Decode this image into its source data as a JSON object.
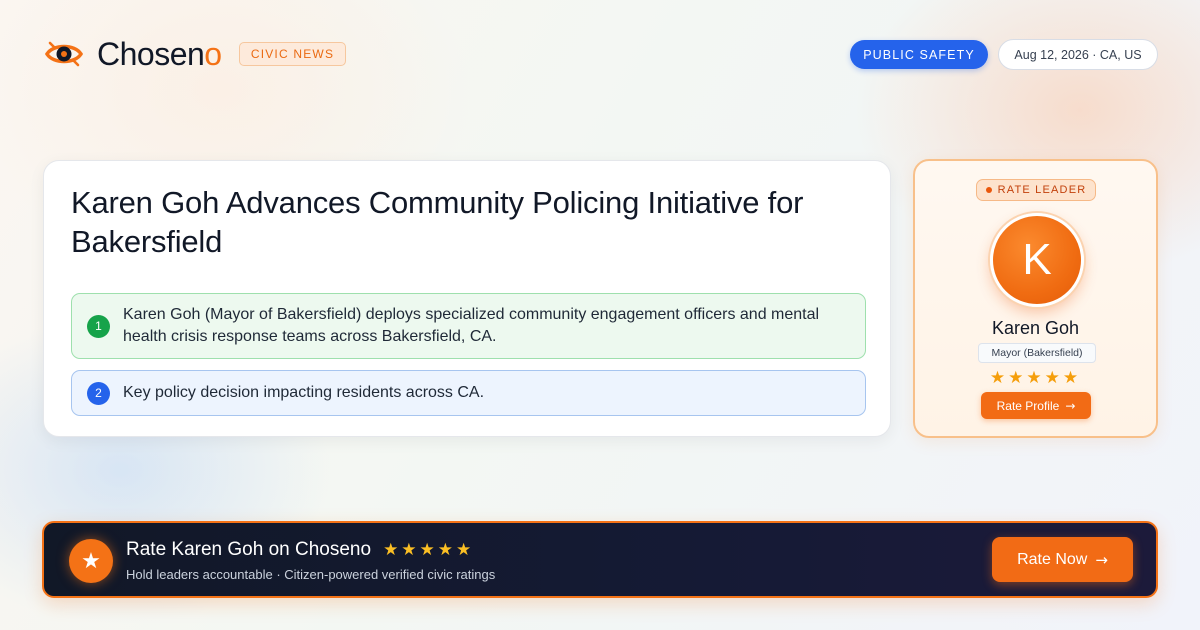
{
  "brand": {
    "name_main": "Chosen",
    "name_accent": "o",
    "tag": "CIVIC NEWS",
    "accent_color": "#f47216",
    "logo_icon": "eye-icon"
  },
  "header": {
    "category": "PUBLIC SAFETY",
    "date_location": "Aug 12, 2026 · CA, US"
  },
  "article": {
    "headline": "Karen Goh Advances Community Policing Initiative  for Bakersfield",
    "points": [
      {
        "number": "1",
        "text": "Karen Goh (Mayor of Bakersfield) deploys specialized community engagement officers  and mental health crisis response teams across Bakersfield,  CA.",
        "color": "#16a34a"
      },
      {
        "number": "2",
        "text": "Key policy decision impacting residents across CA.",
        "color": "#2563eb"
      }
    ]
  },
  "leader_card": {
    "badge": "RATE LEADER",
    "avatar_initial": "K",
    "name": "Karen Goh",
    "role": "Mayor (Bakersfield)",
    "stars": "★★★★★",
    "rating_out_of_5": 5,
    "button_label": "Rate Profile"
  },
  "cta": {
    "title": "Rate Karen Goh on Choseno",
    "stars": "★★★★★",
    "subtitle": "Hold leaders accountable · Citizen-powered  verified  civic ratings",
    "button_label": "Rate Now",
    "icon": "star-icon"
  }
}
